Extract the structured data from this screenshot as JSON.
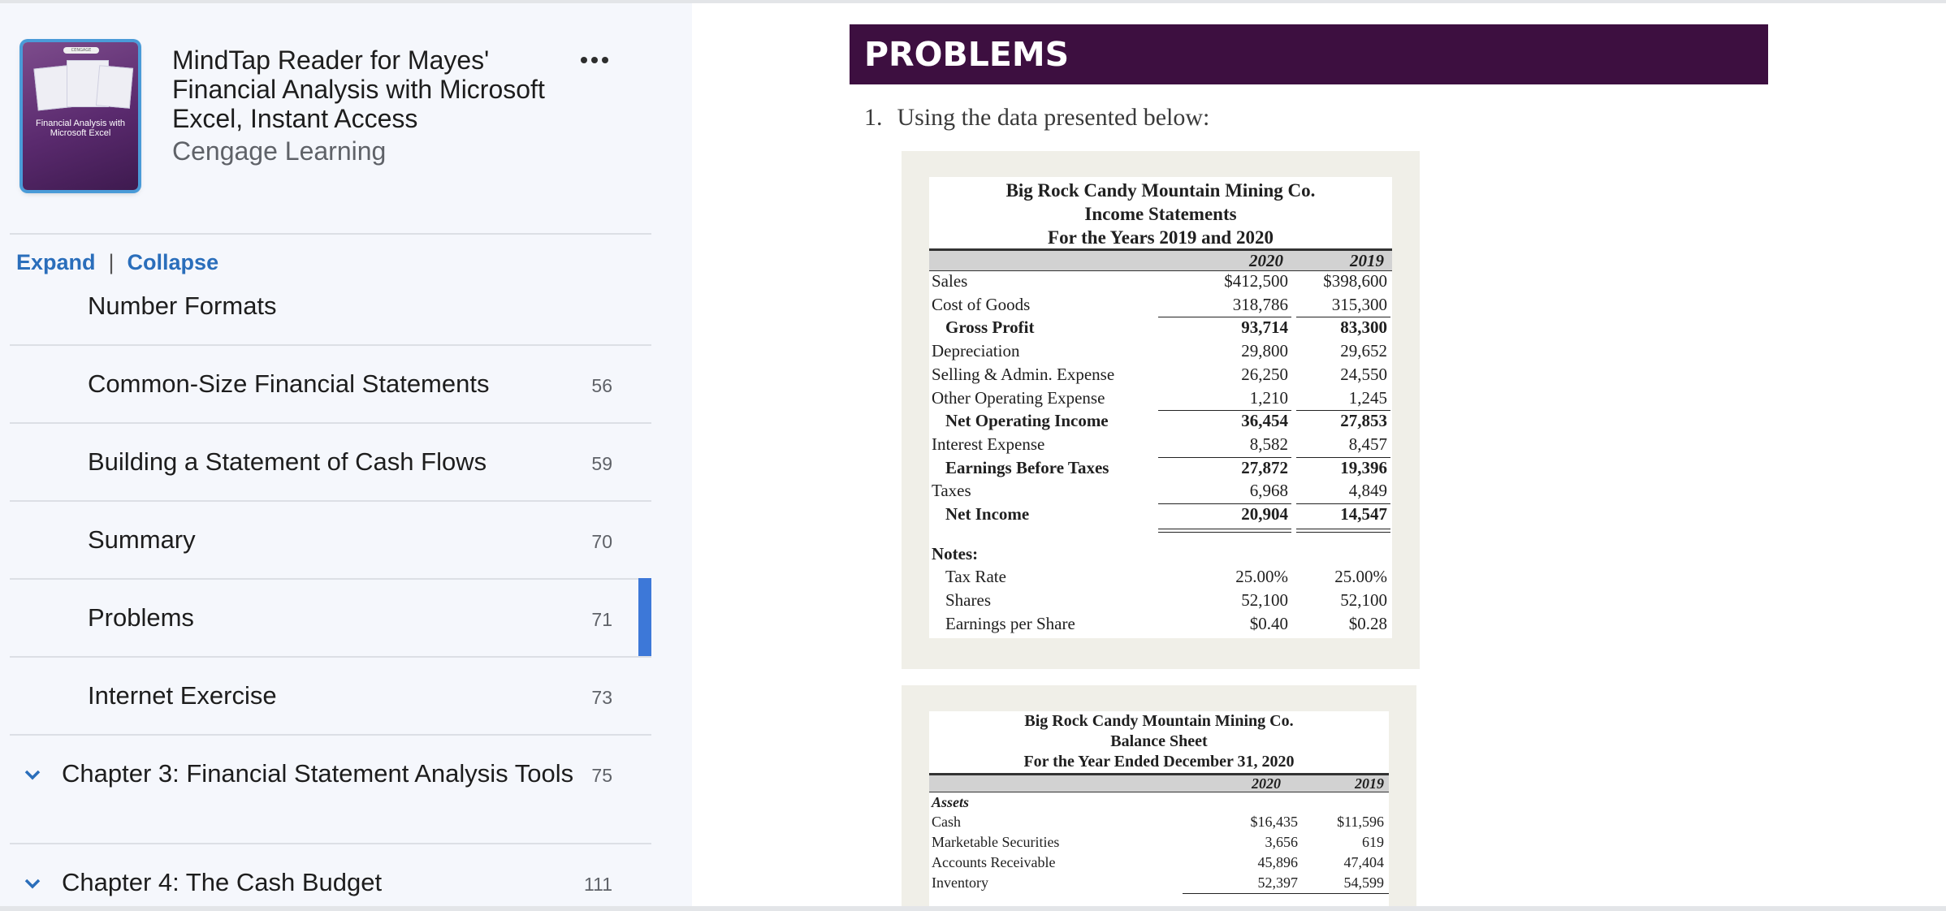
{
  "book": {
    "title": "MindTap Reader for Mayes' Financial Analysis with Microsoft Excel, Instant Access",
    "publisher": "Cengage Learning",
    "cover": {
      "logo_text": "CENGAGE",
      "title": "Financial Analysis with Microsoft Excel"
    }
  },
  "toc": {
    "expand_label": "Expand",
    "divider": "|",
    "collapse_label": "Collapse",
    "items": [
      {
        "label": "Number Formats",
        "page": ""
      },
      {
        "label": "Common-Size Financial Statements",
        "page": "56"
      },
      {
        "label": "Building a Statement of Cash Flows",
        "page": "59"
      },
      {
        "label": "Summary",
        "page": "70"
      },
      {
        "label": "Problems",
        "page": "71"
      },
      {
        "label": "Internet Exercise",
        "page": "73"
      },
      {
        "label": "Chapter 3: Financial Statement Analysis Tools",
        "page": "75"
      },
      {
        "label": "Chapter 4: The Cash Budget",
        "page": "111"
      }
    ]
  },
  "content": {
    "section_title": "PROBLEMS",
    "problem_number": "1.",
    "problem_text": "Using the data presented below:",
    "income": {
      "title1": "Big Rock Candy Mountain Mining Co.",
      "title2": "Income Statements",
      "title3": "For the Years 2019 and 2020",
      "col1": "2020",
      "col2": "2019",
      "rows": [
        {
          "label": "Sales",
          "v1": "$412,500",
          "v2": "$398,600"
        },
        {
          "label": "Cost of Goods",
          "v1": "318,786",
          "v2": "315,300"
        },
        {
          "label": "Gross Profit",
          "v1": "93,714",
          "v2": "83,300"
        },
        {
          "label": "Depreciation",
          "v1": "29,800",
          "v2": "29,652"
        },
        {
          "label": "Selling & Admin. Expense",
          "v1": "26,250",
          "v2": "24,550"
        },
        {
          "label": "Other Operating Expense",
          "v1": "1,210",
          "v2": "1,245"
        },
        {
          "label": "Net Operating Income",
          "v1": "36,454",
          "v2": "27,853"
        },
        {
          "label": "Interest Expense",
          "v1": "8,582",
          "v2": "8,457"
        },
        {
          "label": "Earnings Before Taxes",
          "v1": "27,872",
          "v2": "19,396"
        },
        {
          "label": "Taxes",
          "v1": "6,968",
          "v2": "4,849"
        },
        {
          "label": "Net Income",
          "v1": "20,904",
          "v2": "14,547"
        }
      ],
      "notes_label": "Notes:",
      "notes": [
        {
          "label": "Tax Rate",
          "v1": "25.00%",
          "v2": "25.00%"
        },
        {
          "label": "Shares",
          "v1": "52,100",
          "v2": "52,100"
        },
        {
          "label": "Earnings per Share",
          "v1": "$0.40",
          "v2": "$0.28"
        }
      ]
    },
    "balance": {
      "title1": "Big Rock Candy Mountain Mining Co.",
      "title2": "Balance Sheet",
      "title3": "For the Year Ended December 31, 2020",
      "col1": "2020",
      "col2": "2019",
      "assets_label": "Assets",
      "rows": [
        {
          "label": "Cash",
          "v1": "$16,435",
          "v2": "$11,596"
        },
        {
          "label": "Marketable Securities",
          "v1": "3,656",
          "v2": "619"
        },
        {
          "label": "Accounts Receivable",
          "v1": "45,896",
          "v2": "47,404"
        },
        {
          "label": "Inventory",
          "v1": "52,397",
          "v2": "54,599"
        }
      ]
    }
  }
}
